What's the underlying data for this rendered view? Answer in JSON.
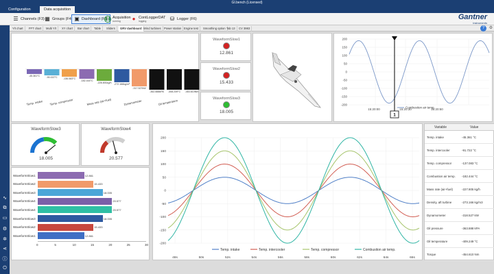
{
  "window": {
    "title": "GI.bench (Licensed)"
  },
  "menu": {
    "tabs": [
      "Configuration",
      "Data acquisition"
    ]
  },
  "toolbar": {
    "channels": "Channels (F3)",
    "groups": "Groups (F4)",
    "dashboard": "Dashboard (F5)",
    "acquisition": "Acquisition",
    "acquisition_status": "running",
    "logger_dat": "ContLoggerDAT",
    "logger_dat_status": "logging",
    "logger": "Logger (F6)"
  },
  "logo": {
    "name": "Gantner",
    "sub": "instruments"
  },
  "page_tabs": [
    "Y/t chart",
    "FFT chart",
    "Multi Y/t",
    "XY chart",
    "Bar chart",
    "Table",
    "Sliders",
    "GRV dashboard",
    "Wind turbines",
    "Power station",
    "Engine test",
    "Smoothing option",
    "Tab 13",
    "CV 3983"
  ],
  "barchart": {
    "values": [
      "-45.361°C",
      "-90.022°C",
      "-136.083°C",
      "-182.444°C",
      "-226.801kg/h",
      "-272.166kg/m³",
      "-317.527kW",
      "-362.888kPA",
      "-408.249°C",
      "-453.610Nm"
    ],
    "categories": [
      "Temp. intake",
      "Temp. compressor",
      "Mass rate (air+fuel)",
      "Dynamometer",
      "Oil temperature"
    ],
    "colors": [
      "#7b68b5",
      "#5ab0d6",
      "#f0a04b",
      "#8c6bb1",
      "#6cab3c",
      "#2e5aa0",
      "#f19a6a",
      "#111111",
      "#111111",
      "#111111"
    ]
  },
  "leds": [
    {
      "name": "WaveformSlow1",
      "value": "12.861",
      "color": "#d32222"
    },
    {
      "name": "WaveformSlow2",
      "value": "15.433",
      "color": "#d32222"
    },
    {
      "name": "WaveformSlow3",
      "value": "18.005",
      "color": "#2ebd33"
    }
  ],
  "sine_top": {
    "yticks": [
      "200",
      "150",
      "100",
      "50",
      "0",
      "-50",
      "-100",
      "-150",
      "-200"
    ],
    "xticks": [
      "15:20:00",
      "15:20:30",
      "15:20:50"
    ],
    "legend": "Combusiton air temp.",
    "cursor": "1"
  },
  "gauges": [
    {
      "name": "WaveformSlow3",
      "value": "18.005"
    },
    {
      "name": "WaveformSlow4",
      "value": "20.577"
    }
  ],
  "hbars": {
    "rows": [
      {
        "label": "WaveformSlow1",
        "value": "12.861",
        "color": "#8c6bb1",
        "frac": 0.429
      },
      {
        "label": "WaveformSlow2",
        "value": "15.433",
        "color": "#f19a6a",
        "frac": 0.514
      },
      {
        "label": "WaveformSlow3",
        "value": "18.005",
        "color": "#4aa6d8",
        "frac": 0.6
      },
      {
        "label": "WaveformSlow4",
        "value": "20.577",
        "color": "#7b5fa8",
        "frac": 0.686
      },
      {
        "label": "WaveformSlow4",
        "value": "20.577",
        "color": "#2fbfa4",
        "frac": 0.686
      },
      {
        "label": "WaveformSlow3",
        "value": "18.005",
        "color": "#2e5aa0",
        "frac": 0.6
      },
      {
        "label": "WaveformSlow2",
        "value": "15.433",
        "color": "#c8483e",
        "frac": 0.514
      },
      {
        "label": "WaveformSlow1",
        "value": "12.861",
        "color": "#3f6fc4",
        "frac": 0.429
      }
    ],
    "xticks": [
      "0",
      "5",
      "10",
      "15",
      "20",
      "25",
      "30"
    ]
  },
  "chart_data": {
    "type": "line",
    "x": [
      "48s",
      "50s",
      "52s",
      "54s",
      "56s",
      "58s",
      "60s",
      "62s",
      "64s",
      "66s"
    ],
    "yticks": [
      "200",
      "150",
      "100",
      "50",
      "0",
      "-50",
      "-100",
      "-150",
      "-200"
    ],
    "ylim": [
      -200,
      200
    ],
    "series": [
      {
        "name": "Temp. intake",
        "color": "#4f7fc7",
        "amplitude": 50
      },
      {
        "name": "Temp. intercooler",
        "color": "#d25d52",
        "amplitude": 100
      },
      {
        "name": "Temp. compressor",
        "color": "#a6c46b",
        "amplitude": 150
      },
      {
        "name": "Combusiton air temp.",
        "color": "#2fb5a4",
        "amplitude": 200
      }
    ]
  },
  "vartable": {
    "headers": [
      "Variable",
      "Value"
    ],
    "rows": [
      [
        "Temp. intake",
        "-45.361 °C"
      ],
      [
        "Temp. intercooler",
        "-91.722 °C"
      ],
      [
        "Temp. compressor",
        "-137.083 °C"
      ],
      [
        "Combustion air temp.",
        "-182.444 °C"
      ],
      [
        "Mass rate (air+fuel)",
        "-227.805 kg/h"
      ],
      [
        "Density, aft turbine",
        "-273.166 kg/m3"
      ],
      [
        "Dynamometer",
        "-318.527 kW"
      ],
      [
        "Oil pressure",
        "-363.888 kPA"
      ],
      [
        "Oil temperature",
        "-409.249 °C"
      ],
      [
        "Torque",
        "-454.610 Nm"
      ]
    ]
  }
}
